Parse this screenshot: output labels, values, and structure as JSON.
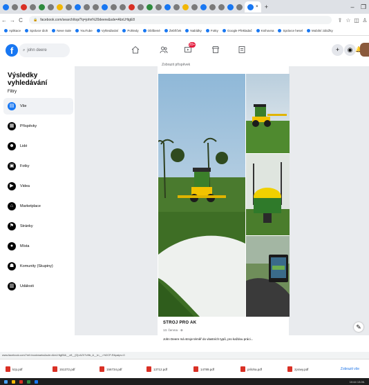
{
  "browser": {
    "active_tab_close": "×",
    "new_tab": "+",
    "minimize": "–",
    "restore": "❐",
    "back": "←",
    "forward": "→",
    "reload": "C",
    "url": "facebook.com/search/top/?q=john%20deere&sde=AbrLHtgE8",
    "share": "⇪",
    "star": "☆",
    "extensions": "◫",
    "profile": "♙",
    "bookmarks": [
      "Aplikace",
      "Správce úloh",
      "Neve Sale",
      "YouTube",
      "Vyhledávání",
      "Pohledy",
      "Oblíbené",
      "Žebříček",
      "Nabídky",
      "Fotky",
      "Google Překladač",
      "Knihovna",
      "Správce hesel",
      "Mobilní záložky"
    ]
  },
  "fb": {
    "logo": "f",
    "search_value": "john deere",
    "notif_count": "20+",
    "plus": "+",
    "messenger": "◉",
    "bell": "🔔"
  },
  "sidebar": {
    "title": "Výsledky vyhledávání",
    "filters_label": "Filtry",
    "items": [
      {
        "label": "Vše"
      },
      {
        "label": "Příspěvky"
      },
      {
        "label": "Lidé"
      },
      {
        "label": "Fotky"
      },
      {
        "label": "Videa"
      },
      {
        "label": "Marketplace"
      },
      {
        "label": "Stránky"
      },
      {
        "label": "Místa"
      },
      {
        "label": "Komunity (Skupiny)"
      },
      {
        "label": "Události"
      }
    ]
  },
  "post": {
    "header": "Zobrazit příspěvek",
    "title": "STROJ PRO AK",
    "date": "13. června · ⊕",
    "text": "John Deere má stroje téměř do vlastních typů, pro každou práci..."
  },
  "statusbar": {
    "url": "www.facebook.com/?ref=bookmarks&sde=AbrLHtgE8&__cft__[0]=AZX7v9tk_&__tn__=%2CP-R&paipv=0"
  },
  "downloads": {
    "items": [
      {
        "name": "kzp.pdf"
      },
      {
        "name": "151372.pdf"
      },
      {
        "name": "156734.pdf"
      },
      {
        "name": "13712.pdf"
      },
      {
        "name": "14789.pdf"
      },
      {
        "name": "priloha.pdf"
      },
      {
        "name": "zpravy.pdf"
      }
    ],
    "show_all": "Zobrazit vše"
  },
  "taskbar": {
    "clock": "10:44 13.06."
  }
}
